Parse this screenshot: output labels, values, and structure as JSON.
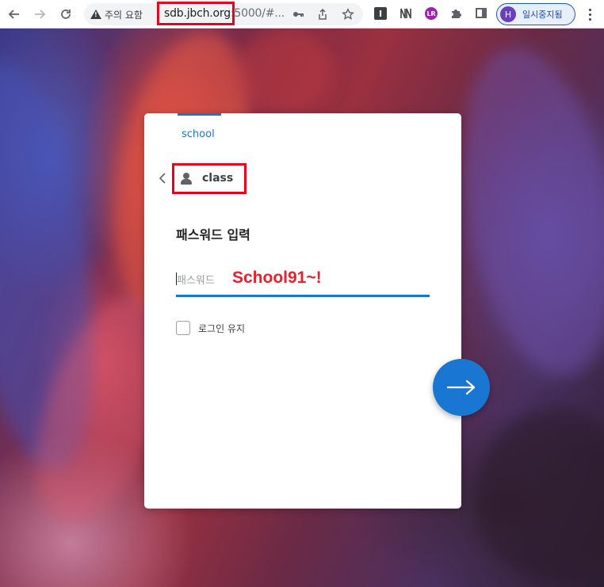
{
  "browser": {
    "address": {
      "security_label": "주의 요함",
      "url_host": "sdb.jbch.org",
      "url_rest": ":5000/#..."
    },
    "profile": {
      "avatar_letter": "H",
      "label": "일시중지됨"
    },
    "extensions": [
      {
        "icon": "instapaper-icon",
        "letter": "I"
      },
      {
        "icon": "notion-icon",
        "letter": "N"
      },
      {
        "icon": "lr-icon",
        "letter": "LR"
      }
    ]
  },
  "login": {
    "tab_label": "school",
    "account_label": "class",
    "title": "패스워드 입력",
    "password": {
      "placeholder": "패스워드",
      "annotation": "School91~!"
    },
    "keep_login_label": "로그인 유지"
  },
  "colors": {
    "accent": "#1976d2",
    "annotation_red": "#e8202c"
  }
}
